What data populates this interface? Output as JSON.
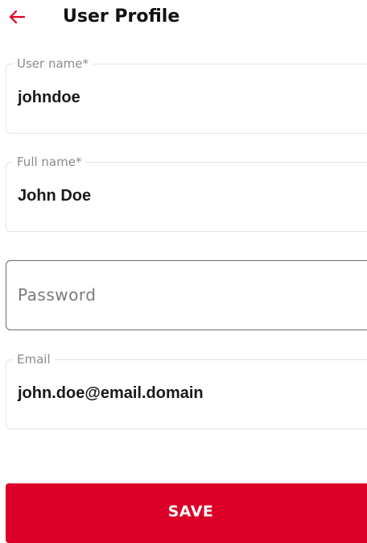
{
  "colors": {
    "accent": "#dc0028",
    "label": "#8a8a8a",
    "border": "#e4e4e4",
    "border_active": "#6b6b6b"
  },
  "header": {
    "back_icon": "arrow-left-icon",
    "title": "User Profile"
  },
  "form": {
    "username": {
      "label": "User name*",
      "value": "johndoe"
    },
    "fullname": {
      "label": "Full name*",
      "value": "John Doe"
    },
    "password": {
      "placeholder": "Password"
    },
    "email": {
      "label": "Email",
      "value": "john.doe@email.domain"
    }
  },
  "actions": {
    "save_label": "SAVE"
  }
}
